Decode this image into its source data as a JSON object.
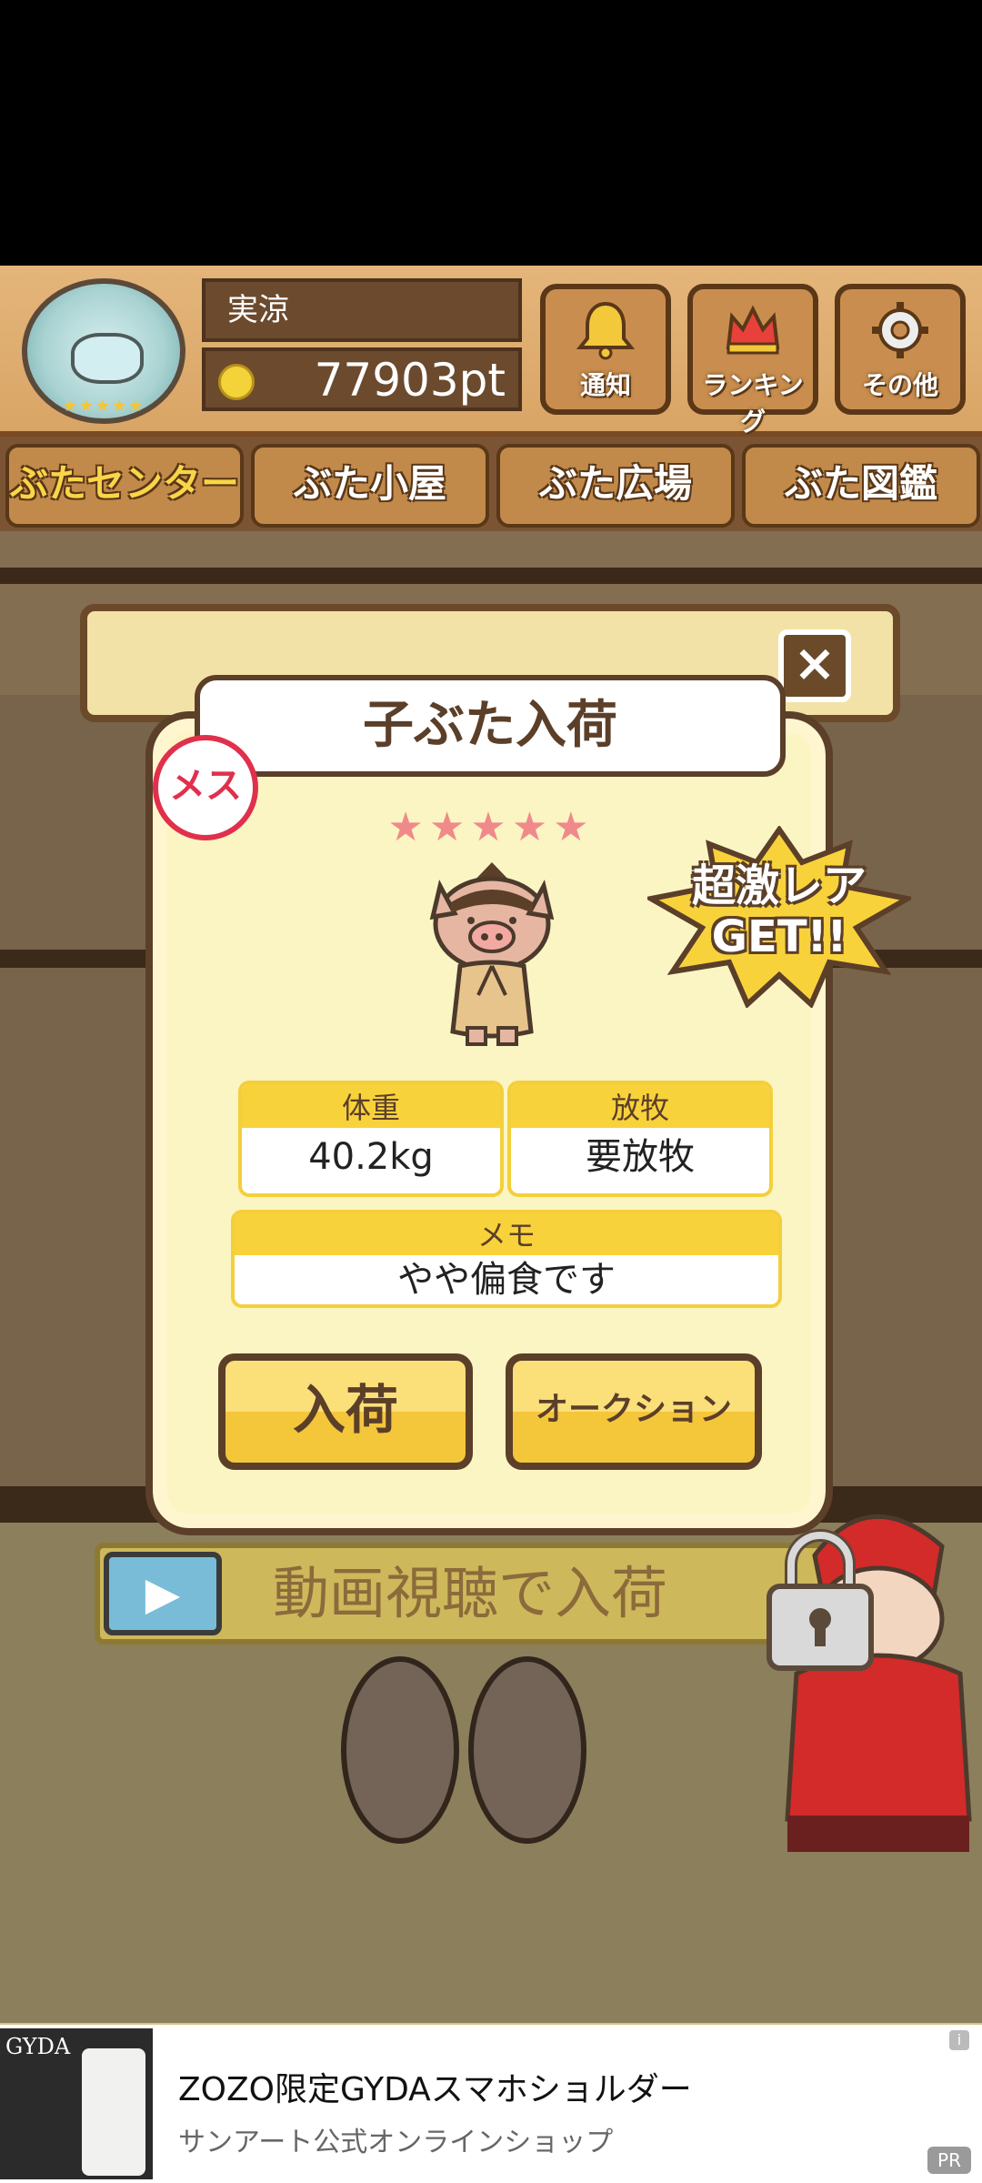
{
  "header": {
    "player_name": "実涼",
    "points": "77903pt",
    "buttons": [
      {
        "label": "通知",
        "icon": "bell-icon"
      },
      {
        "label": "ランキング",
        "icon": "crown-icon"
      },
      {
        "label": "その他",
        "icon": "gear-icon"
      }
    ]
  },
  "nav": {
    "tabs": [
      "ぶたセンター",
      "ぶた小屋",
      "ぶた広場",
      "ぶた図鑑"
    ],
    "active_index": 0
  },
  "background_panel": {
    "title_partial": "子ぶた入荷"
  },
  "modal": {
    "title": "子ぶた入荷",
    "gender_badge": "メス",
    "stars": "★★★★★",
    "rarity_badge": "超激レア\nGET!!",
    "stats": [
      {
        "label": "体重",
        "value": "40.2kg"
      },
      {
        "label": "放牧",
        "value": "要放牧"
      }
    ],
    "memo": {
      "label": "メモ",
      "value": "やや偏食です"
    },
    "buttons": {
      "stock": "入荷",
      "auction": "オークション"
    }
  },
  "video_banner": {
    "label": "動画視聴で入荷"
  },
  "ad": {
    "brand": "GYDA",
    "title": "ZOZO限定GYDAスマホショルダー",
    "subtitle": "サンアート公式オンラインショップ",
    "info": "i",
    "pr": "PR"
  },
  "colors": {
    "accent": "#f8d23a",
    "wood": "#c98e4f",
    "dark_brown": "#5b3f29",
    "female": "#e0304c"
  }
}
